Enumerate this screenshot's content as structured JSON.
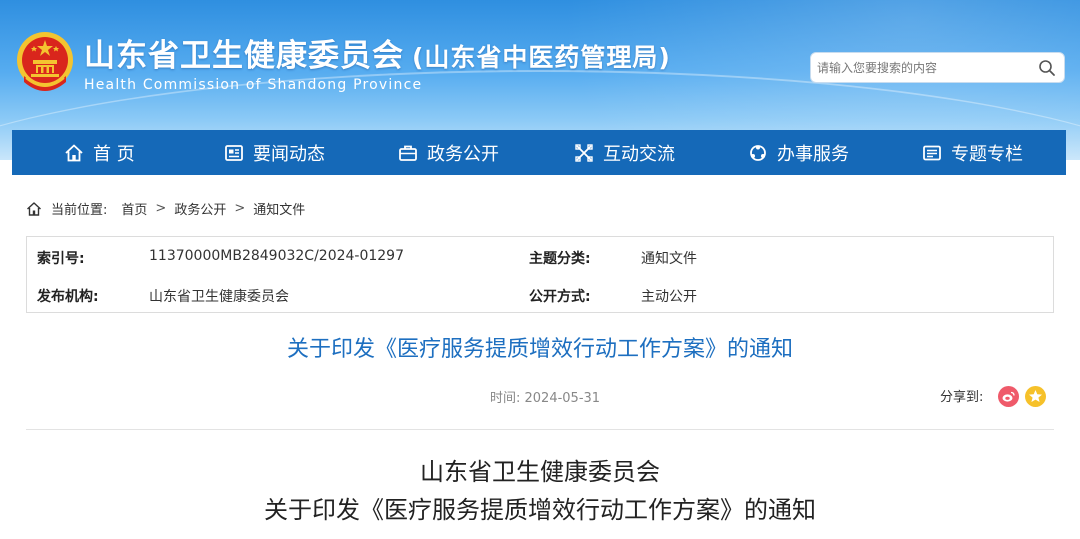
{
  "header": {
    "site_title": "山东省卫生健康委员会",
    "site_subtitle": "(山东省中医药管理局)",
    "site_title_en": "Health Commission of Shandong Province",
    "emblem_icon": "national-emblem-icon"
  },
  "search": {
    "placeholder": "请输入您要搜索的内容",
    "icon": "search-icon"
  },
  "nav": {
    "items": [
      {
        "label": "首 页",
        "icon": "home-icon"
      },
      {
        "label": "要闻动态",
        "icon": "news-icon"
      },
      {
        "label": "政务公开",
        "icon": "briefcase-icon"
      },
      {
        "label": "互动交流",
        "icon": "interaction-icon"
      },
      {
        "label": "办事服务",
        "icon": "service-icon"
      },
      {
        "label": "专题专栏",
        "icon": "topic-icon"
      }
    ]
  },
  "breadcrumb": {
    "prefix": "当前位置:",
    "items": [
      "首页",
      "政务公开",
      "通知文件"
    ],
    "separator": ">"
  },
  "meta": {
    "index_label": "索引号:",
    "index_value": "11370000MB2849032C/2024-01297",
    "topic_label": "主题分类:",
    "topic_value": "通知文件",
    "publisher_label": "发布机构:",
    "publisher_value": "山东省卫生健康委员会",
    "method_label": "公开方式:",
    "method_value": "主动公开"
  },
  "article": {
    "title": "关于印发《医疗服务提质增效行动工作方案》的通知",
    "time": "时间: 2024-05-31",
    "share_label": "分享到:",
    "doc_org": "山东省卫生健康委员会",
    "doc_title": "关于印发《医疗服务提质增效行动工作方案》的通知"
  },
  "colors": {
    "nav_bg": "#1569b8",
    "title_blue": "#1d6fc0",
    "weibo": "#ef5a6a",
    "qzone": "#f6c12a"
  }
}
